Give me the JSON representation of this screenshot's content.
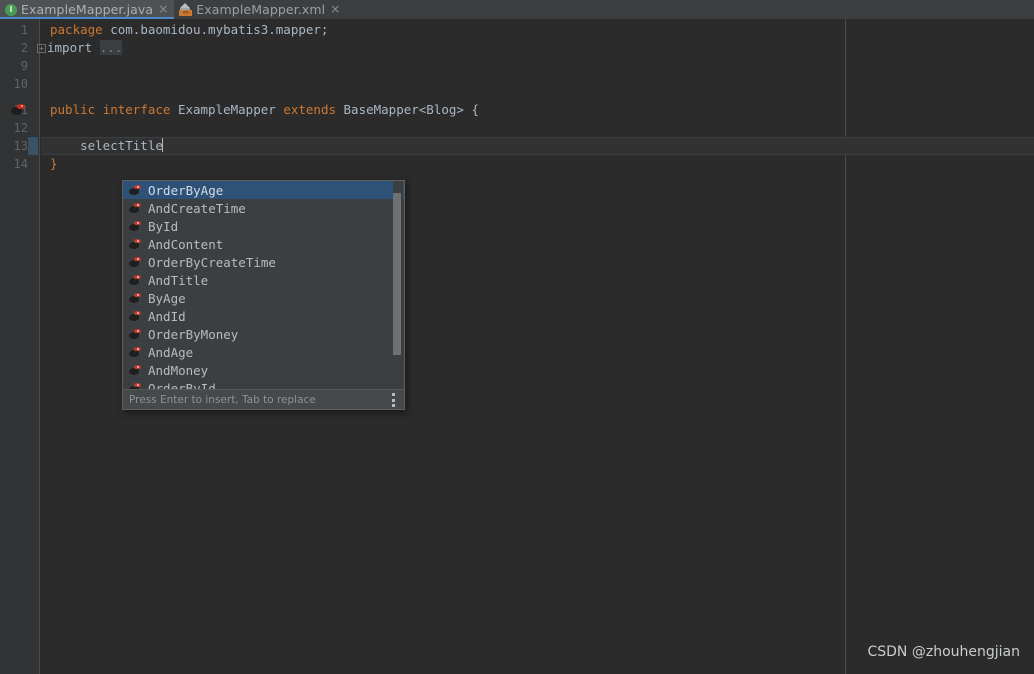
{
  "window": {
    "theme": "darcula",
    "background": "#2b2b2b"
  },
  "tabs": [
    {
      "label": "ExampleMapper.java",
      "icon": "java-interface-icon",
      "icon_letter": "I",
      "active": true,
      "close_glyph": "×"
    },
    {
      "label": "ExampleMapper.xml",
      "icon": "mybatis-xml-mapper-icon",
      "icon_letter": "<>",
      "active": false,
      "close_glyph": "×"
    }
  ],
  "editor": {
    "file": "ExampleMapper.java",
    "lines": [
      {
        "no": "1",
        "indent": 0,
        "segments": [
          {
            "t": "package",
            "c": "kw"
          },
          {
            "t": " com.baomidou.mybatis3.mapper;",
            "c": "txt"
          }
        ]
      },
      {
        "no": "2",
        "indent": 0,
        "fold": true,
        "segments": [
          {
            "t": "import",
            "c": "txt"
          },
          {
            "t": " ",
            "c": "txt"
          },
          {
            "t": "...",
            "c": "fold"
          }
        ]
      },
      {
        "no": "9",
        "indent": 0,
        "segments": []
      },
      {
        "no": "10",
        "indent": 0,
        "segments": []
      },
      {
        "no": "11",
        "indent": 0,
        "gutter_icon": "mybatis-nav-icon",
        "segments": [
          {
            "t": "public",
            "c": "kw"
          },
          {
            "t": " ",
            "c": "txt"
          },
          {
            "t": "interface",
            "c": "kw"
          },
          {
            "t": " ExampleMapper ",
            "c": "txt"
          },
          {
            "t": "extends",
            "c": "kw"
          },
          {
            "t": " BaseMapper<Blog> {",
            "c": "txt"
          }
        ]
      },
      {
        "no": "12",
        "indent": 0,
        "segments": []
      },
      {
        "no": "13",
        "indent": 0,
        "caret_line": true,
        "segments": [
          {
            "t": "    selectTitle",
            "c": "txt"
          }
        ]
      },
      {
        "no": "14",
        "indent": 0,
        "segments": [
          {
            "t": "}",
            "c": "kw"
          }
        ]
      }
    ],
    "caret_text": "selectTitle",
    "margin_guide_column": true
  },
  "completion_popup": {
    "items": [
      {
        "label": "OrderByAge",
        "icon": "mybatis-method-icon",
        "selected": true
      },
      {
        "label": "AndCreateTime",
        "icon": "mybatis-method-icon",
        "selected": false
      },
      {
        "label": "ById",
        "icon": "mybatis-method-icon",
        "selected": false
      },
      {
        "label": "AndContent",
        "icon": "mybatis-method-icon",
        "selected": false
      },
      {
        "label": "OrderByCreateTime",
        "icon": "mybatis-method-icon",
        "selected": false
      },
      {
        "label": "AndTitle",
        "icon": "mybatis-method-icon",
        "selected": false
      },
      {
        "label": "ByAge",
        "icon": "mybatis-method-icon",
        "selected": false
      },
      {
        "label": "AndId",
        "icon": "mybatis-method-icon",
        "selected": false
      },
      {
        "label": "OrderByMoney",
        "icon": "mybatis-method-icon",
        "selected": false
      },
      {
        "label": "AndAge",
        "icon": "mybatis-method-icon",
        "selected": false
      },
      {
        "label": "AndMoney",
        "icon": "mybatis-method-icon",
        "selected": false
      },
      {
        "label": "OrderById",
        "icon": "mybatis-method-icon",
        "selected": false
      }
    ],
    "footer_hint": "Press Enter to insert, Tab to replace",
    "selected_color": "#2d5177",
    "background": "#3c3f41"
  },
  "watermark": {
    "text": "CSDN @zhouhengjian"
  }
}
